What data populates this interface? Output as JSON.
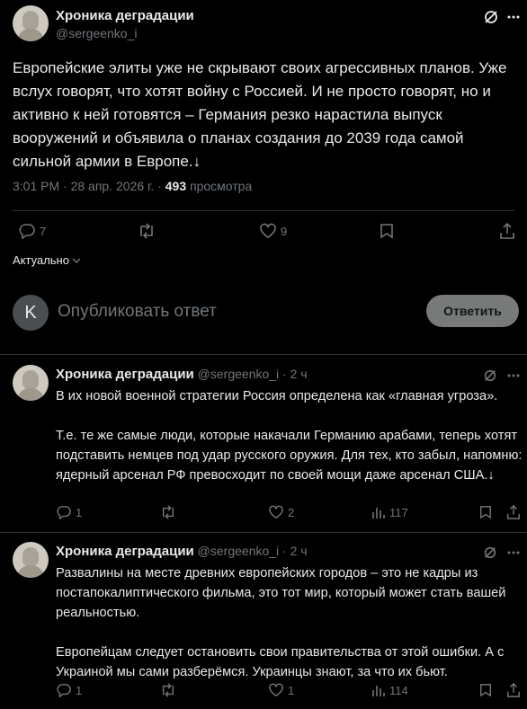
{
  "main_tweet": {
    "author_name": "Хроника деградации",
    "author_handle": "@sergeenko_i",
    "text": "Европейские элиты уже не скрывают своих агрессивных планов. Уже вслух говорят, что хотят войну с Россией. И не просто говорят, но и активно к ней готовятся – Германия резко нарастила выпуск вооружений и объявила о планах создания до 2039 года самой сильной армии в Европе.↓",
    "timestamp": "3:01 PM · 28 апр. 2026 г. ·",
    "views_count": "493",
    "views_label": "просмотра",
    "replies": "7",
    "likes": "9"
  },
  "sort_label": "Актуально",
  "compose": {
    "avatar_letter": "K",
    "placeholder": "Опубликовать ответ",
    "button_label": "Ответить"
  },
  "replies": [
    {
      "author_name": "Хроника деградации",
      "handle_time": "@sergeenko_i · 2 ч",
      "text": "В их новой военной стратегии Россия определена как «главная угроза».\n\nТ.е. те же самые люди, которые накачали Германию арабами, теперь хотят подставить немцев под удар русского оружия. Для тех, кто забыл, напомню: ядерный арсенал РФ превосходит по своей мощи даже арсенал США.↓",
      "replies": "1",
      "likes": "2",
      "views": "117"
    },
    {
      "author_name": "Хроника деградации",
      "handle_time": "@sergeenko_i · 2 ч",
      "text": "Развалины на месте древних европейских городов – это не кадры из постапокалиптического фильма, это тот мир, который может стать вашей реальностью.\n\nЕвропейцам следует остановить свои правительства от этой ошибки. А с Украиной мы сами разберёмся. Украинцы знают, за что их бьют.",
      "replies": "1",
      "likes": "1",
      "views": "114"
    }
  ],
  "colors": {
    "background": "#000000",
    "text": "#e7e9ea",
    "muted": "#71767b",
    "divider": "#2f3336",
    "button_bg": "#787a7a"
  }
}
